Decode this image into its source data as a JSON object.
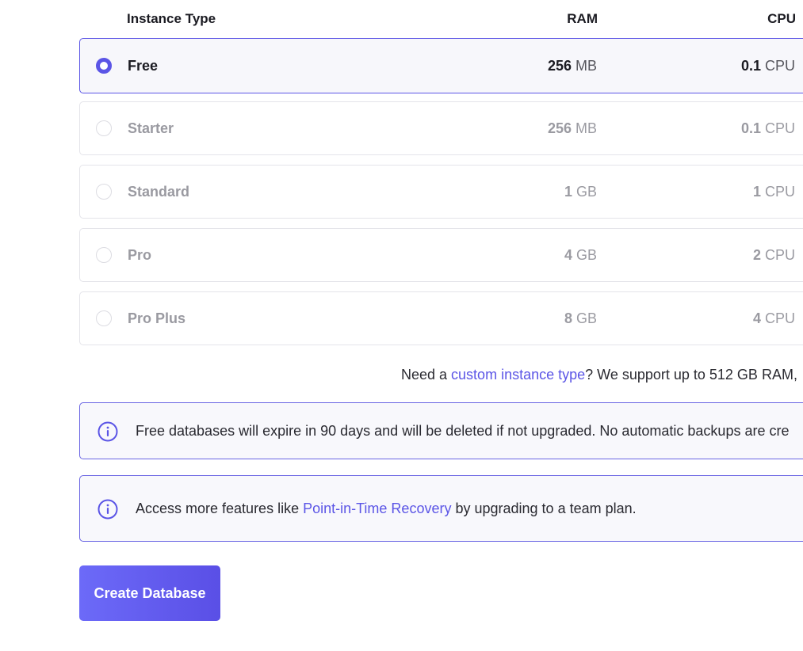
{
  "table": {
    "headers": {
      "instance_type": "Instance Type",
      "ram": "RAM",
      "cpu": "CPU"
    },
    "rows": [
      {
        "name": "Free",
        "ram_value": "256",
        "ram_unit": "MB",
        "cpu_value": "0.1",
        "cpu_unit": "CPU",
        "selected": true
      },
      {
        "name": "Starter",
        "ram_value": "256",
        "ram_unit": "MB",
        "cpu_value": "0.1",
        "cpu_unit": "CPU",
        "selected": false
      },
      {
        "name": "Standard",
        "ram_value": "1",
        "ram_unit": "GB",
        "cpu_value": "1",
        "cpu_unit": "CPU",
        "selected": false
      },
      {
        "name": "Pro",
        "ram_value": "4",
        "ram_unit": "GB",
        "cpu_value": "2",
        "cpu_unit": "CPU",
        "selected": false
      },
      {
        "name": "Pro Plus",
        "ram_value": "8",
        "ram_unit": "GB",
        "cpu_value": "4",
        "cpu_unit": "CPU",
        "selected": false
      }
    ]
  },
  "custom_note": {
    "prefix": "Need a ",
    "link": "custom instance type",
    "suffix": "? We support up to 512 GB RAM,"
  },
  "notices": {
    "expiry": {
      "icon": "info-icon",
      "text": "Free databases will expire in 90 days and will be deleted if not upgraded. No automatic backups are cre"
    },
    "features": {
      "icon": "info-icon",
      "prefix": "Access more features like ",
      "link": "Point-in-Time Recovery",
      "suffix": " by upgrading to a team plan."
    }
  },
  "actions": {
    "create_label": "Create Database"
  },
  "colors": {
    "accent": "#5b55e6",
    "muted_text": "#9a9aa1",
    "info_border": "#6a65e3",
    "button_gradient_start": "#6c6af8",
    "button_gradient_end": "#5a4fe6"
  }
}
